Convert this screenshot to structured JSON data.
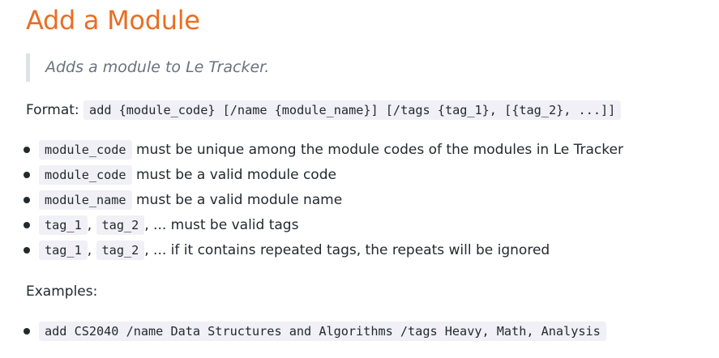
{
  "heading": {
    "title": "Add a Module"
  },
  "description": "Adds a module to Le Tracker.",
  "format": {
    "label": "Format:",
    "command": "add {module_code} [/name {module_name}] [/tags {tag_1}, [{tag_2}, ...]]"
  },
  "constraints": [
    {
      "codes": [
        "module_code"
      ],
      "text": " must be unique among the module codes of the modules in Le Tracker"
    },
    {
      "codes": [
        "module_code"
      ],
      "text": " must be a valid module code"
    },
    {
      "codes": [
        "module_name"
      ],
      "text": " must be a valid module name"
    },
    {
      "codes": [
        "tag_1",
        "tag_2"
      ],
      "separator": ", ",
      "text": ", ... must be valid tags"
    },
    {
      "codes": [
        "tag_1",
        "tag_2"
      ],
      "separator": ", ",
      "text": ", ... if it contains repeated tags, the repeats will be ignored"
    }
  ],
  "examples": {
    "label": "Examples:",
    "items": [
      "add CS2040 /name Data Structures and Algorithms /tags Heavy, Math, Analysis"
    ]
  }
}
